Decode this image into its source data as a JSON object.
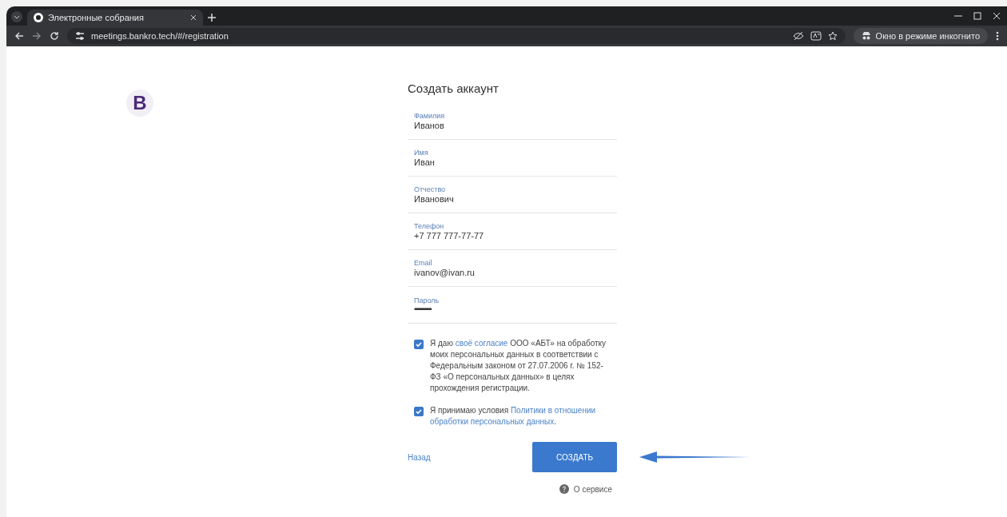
{
  "browser": {
    "tab": {
      "title": "Электронные собрания",
      "selected": true
    },
    "url": "meetings.bankro.tech/#/registration",
    "profile": "Окно в режиме инкогнито"
  },
  "page": {
    "logo": "B",
    "title": "Создать аккаунт",
    "fields": [
      {
        "label": "Фамилия",
        "value": "Иванов",
        "kind": "text"
      },
      {
        "label": "Имя",
        "value": "Иван",
        "kind": "text"
      },
      {
        "label": "Отчество",
        "value": "Иванович",
        "kind": "text"
      },
      {
        "label": "Телефон",
        "value": "+7 777 777-77-77",
        "kind": "text"
      },
      {
        "label": "Email",
        "value": "ivanov@ivan.ru",
        "kind": "text"
      },
      {
        "label": "Пароль",
        "value": "••••••••••••••••••",
        "kind": "password"
      }
    ],
    "consents": [
      {
        "checked": true,
        "before": "Я даю ",
        "link": "своё согласие",
        "after": " ООО «АБТ» на обработку моих персональных данных в соответствии с Федеральным законом от 27.07.2006 г. № 152-ФЗ «О персональных данных» в целях прохождения регистрации."
      },
      {
        "checked": true,
        "before": "Я принимаю условия ",
        "link": [
          "Политики в отношении",
          "обработки персональных данных"
        ],
        "after": "."
      }
    ],
    "back": "Назад",
    "submit": "СОЗДАТЬ",
    "about": "О сервисе"
  }
}
